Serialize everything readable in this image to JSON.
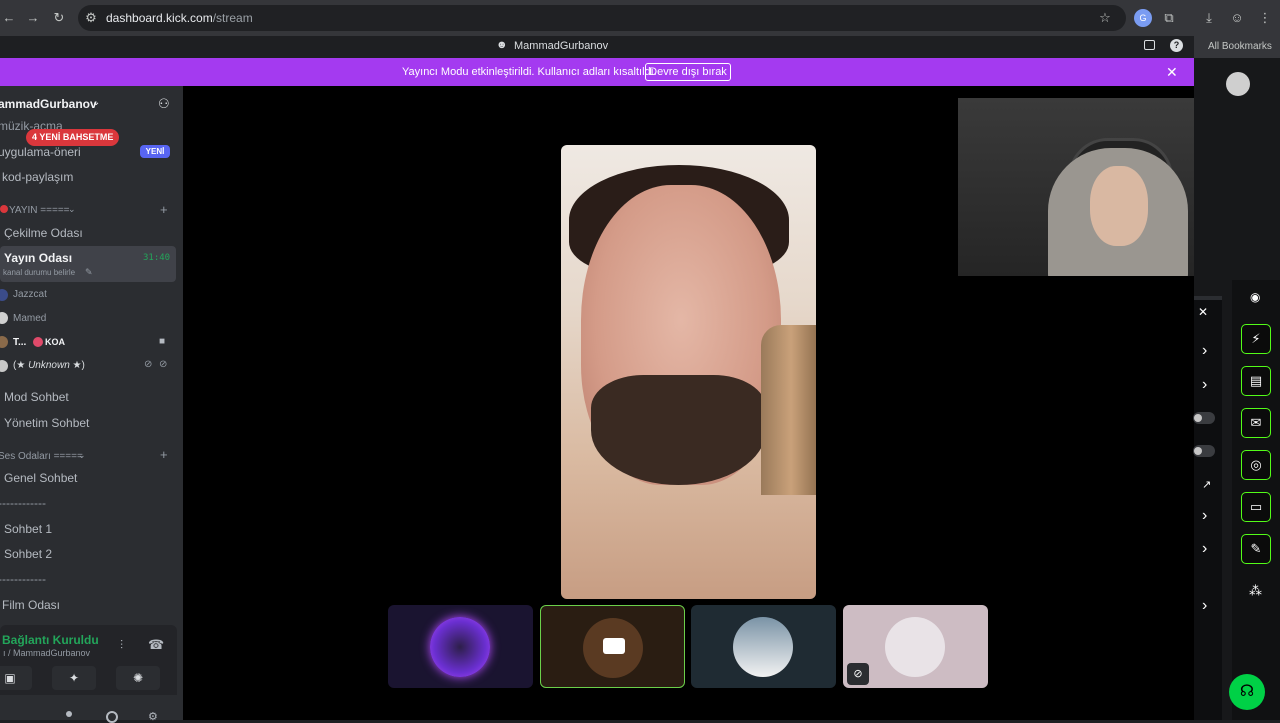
{
  "browser": {
    "url_host": "dashboard.kick.com",
    "url_path": "/stream",
    "bookmarks_label": "All Bookmarks"
  },
  "window": {
    "title": "MammadGurbanov"
  },
  "banner": {
    "text": "Yayıncı Modu etkinleştirildi. Kullanıcı adları kısaltıldı.",
    "button_label": "Devre dışı bırak",
    "accent": "#a43af0"
  },
  "sidebar": {
    "server_name": "ammadGurbanov",
    "mentions_badge": "4 YENİ BAHSETME",
    "new_badge": "YENİ",
    "channels_top": [
      "müzik-açma",
      "uygulama-öneri",
      "kod-paylaşım"
    ],
    "category_stream": "YAYIN =====",
    "channel_cekilme": "Çekilme Odası",
    "active_room": {
      "name": "Yayın Odası",
      "status": "kanal durumu belirle",
      "timer": "31:40"
    },
    "users": [
      "Jazzcat",
      "Mamed",
      "T...",
      "KOA",
      "Unknown"
    ],
    "channels_mid": [
      "Mod Sohbet",
      "Yönetim Sohbet"
    ],
    "category_voice": "Ses Odaları =====",
    "channels_voice": [
      "Genel Sohbet",
      "------------",
      "Sohbet 1",
      "Sohbet 2",
      "------------",
      "Film Odası"
    ],
    "voice_status": "Bağlantı Kuruldu",
    "voice_channel": "ı / MammadGurbanov"
  },
  "colors": {
    "kick_green": "#53fc18",
    "discord_bg": "#2b2d31",
    "voice_green": "#23a55a"
  }
}
